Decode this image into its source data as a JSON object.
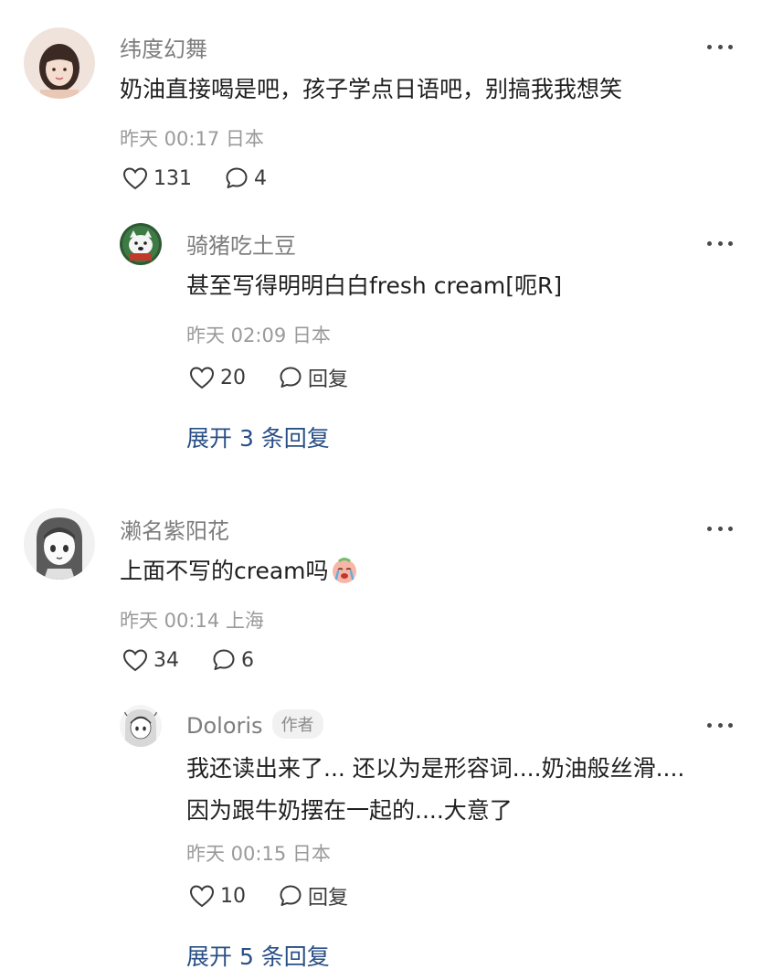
{
  "comments": [
    {
      "username": "纬度幻舞",
      "text": "奶油直接喝是吧，孩子学点日语吧，别搞我我想笑",
      "meta": "昨天 00:17 日本",
      "likes": "131",
      "replies_count": "4",
      "reply": {
        "username": "骑猪吃土豆",
        "text": "甚至写得明明白白fresh cream[呃R]",
        "meta": "昨天 02:09 日本",
        "likes": "20",
        "reply_label": "回复"
      },
      "expand_label": "展开 3 条回复"
    },
    {
      "username": "濑名紫阳花",
      "text": "上面不写的cream吗",
      "meta": "昨天 00:14 上海",
      "likes": "34",
      "replies_count": "6",
      "reply": {
        "username": "Doloris",
        "author_badge": "作者",
        "text_line1": "我还读出来了... 还以为是形容词....奶油般丝滑....",
        "text_line2": "因为跟牛奶摆在一起的....大意了",
        "meta": "昨天 00:15 日本",
        "likes": "10",
        "reply_label": "回复"
      },
      "expand_label": "展开 5 条回复"
    }
  ],
  "icons": {
    "like": "heart-outline-icon",
    "comment": "speech-bubble-icon",
    "more": "more-dots-icon",
    "emoji": "crying-face-emoji"
  },
  "colors": {
    "expand_link": "#294f86",
    "username": "#7d7d7d",
    "meta": "#9a9a9a"
  }
}
